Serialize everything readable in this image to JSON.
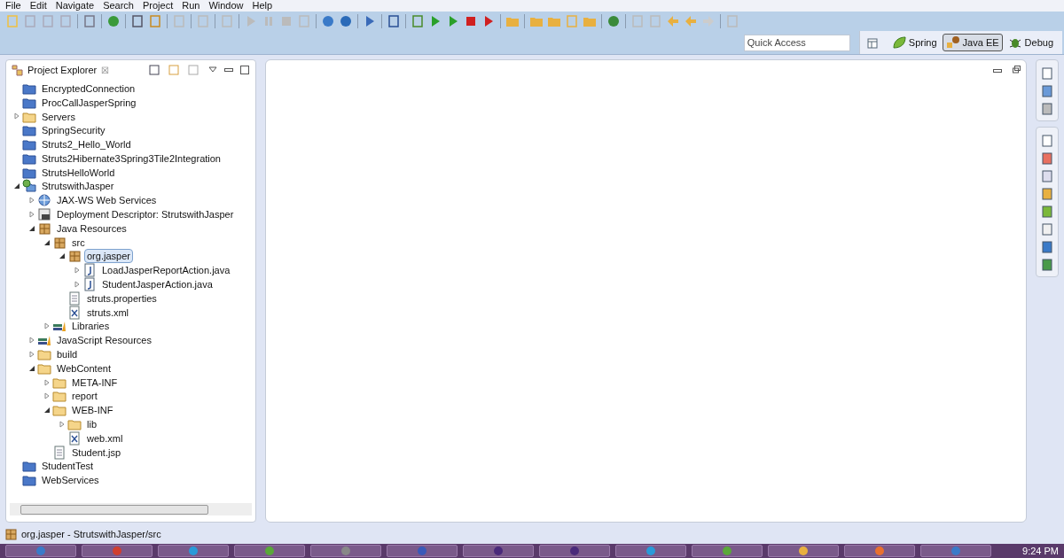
{
  "menu": [
    "File",
    "Edit",
    "Navigate",
    "Search",
    "Project",
    "Run",
    "Window",
    "Help"
  ],
  "quick_access": {
    "placeholder": "Quick Access"
  },
  "perspectives": [
    {
      "label": "Spring",
      "kind": "spring",
      "selected": false
    },
    {
      "label": "Java EE",
      "kind": "javaee",
      "selected": true
    },
    {
      "label": "Debug",
      "kind": "debug",
      "selected": false
    }
  ],
  "explorer": {
    "title": "Project Explorer",
    "close": "☒",
    "tree": [
      {
        "label": "EncryptedConnection",
        "kind": "project"
      },
      {
        "label": "ProcCallJasperSpring",
        "kind": "project"
      },
      {
        "label": "Servers",
        "kind": "folder",
        "expanded": false
      },
      {
        "label": "SpringSecurity",
        "kind": "project"
      },
      {
        "label": "Struts2_Hello_World",
        "kind": "project"
      },
      {
        "label": "Struts2Hibernate3Spring3Tile2Integration",
        "kind": "project"
      },
      {
        "label": "StrutsHelloWorld",
        "kind": "project"
      },
      {
        "label": "StrutswithJasper",
        "kind": "webproject",
        "expanded": true,
        "children": [
          {
            "label": "JAX-WS Web Services",
            "kind": "webservice",
            "expanded": false
          },
          {
            "label": "Deployment Descriptor: StrutswithJasper",
            "kind": "descriptor",
            "expanded": false
          },
          {
            "label": "Java Resources",
            "kind": "package",
            "expanded": true,
            "children": [
              {
                "label": "src",
                "kind": "package",
                "expanded": true,
                "children": [
                  {
                    "label": "org.jasper",
                    "kind": "package",
                    "expanded": true,
                    "selected": true,
                    "children": [
                      {
                        "label": "LoadJasperReportAction.java",
                        "kind": "java",
                        "expanded": false,
                        "selected": false
                      },
                      {
                        "label": "StudentJasperAction.java",
                        "kind": "java",
                        "expanded": false,
                        "selected": false
                      }
                    ]
                  },
                  {
                    "label": "struts.properties",
                    "kind": "text",
                    "selected": false
                  },
                  {
                    "label": "struts.xml",
                    "kind": "xml",
                    "selected": false
                  }
                ]
              },
              {
                "label": "Libraries",
                "kind": "library",
                "expanded": false
              }
            ]
          },
          {
            "label": "JavaScript Resources",
            "kind": "library",
            "expanded": false
          },
          {
            "label": "build",
            "kind": "folder",
            "expanded": false
          },
          {
            "label": "WebContent",
            "kind": "folder",
            "expanded": true,
            "children": [
              {
                "label": "META-INF",
                "kind": "folder",
                "expanded": false
              },
              {
                "label": "report",
                "kind": "folder",
                "expanded": false
              },
              {
                "label": "WEB-INF",
                "kind": "folder",
                "expanded": true,
                "children": [
                  {
                    "label": "lib",
                    "kind": "folder",
                    "expanded": false
                  },
                  {
                    "label": "web.xml",
                    "kind": "xml"
                  }
                ]
              },
              {
                "label": "Student.jsp",
                "kind": "text"
              }
            ]
          }
        ]
      },
      {
        "label": "StudentTest",
        "kind": "project"
      },
      {
        "label": "WebServices",
        "kind": "project"
      }
    ]
  },
  "status_bar": {
    "text": "org.jasper - StrutswithJasper/src"
  },
  "taskbar": {
    "clock": "9:24 PM"
  }
}
